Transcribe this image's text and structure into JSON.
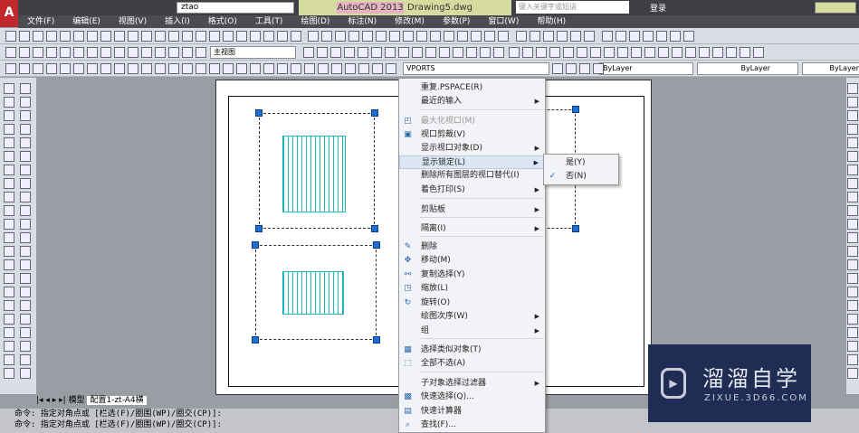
{
  "title": {
    "app": "AutoCAD 2013",
    "document": "Drawing5.dwg",
    "workspace": "ztao",
    "search_placeholder": "键入关键字或短语",
    "login": "登录"
  },
  "menubar": [
    "文件(F)",
    "编辑(E)",
    "视图(V)",
    "插入(I)",
    "格式(O)",
    "工具(T)",
    "绘图(D)",
    "标注(N)",
    "修改(M)",
    "参数(P)",
    "窗口(W)",
    "帮助(H)"
  ],
  "toolbar": {
    "view_select": "主视图",
    "layer_select": "VPORTS",
    "color_select": "ByLayer",
    "linetype_select": "ByLayer",
    "lineweight_select": "ByLayer"
  },
  "tabs": {
    "model": "模型",
    "layout": "配置1-zt-A4横"
  },
  "command_lines": [
    "命令: 指定对角点或 [栏选(F)/圈围(WP)/圈交(CP)]:",
    "命令: 指定对角点或 [栏选(F)/圈围(WP)/圈交(CP)]:"
  ],
  "context_menu": [
    {
      "label": "重复.PSPACE(R)"
    },
    {
      "label": "最近的输入",
      "submenu": true
    },
    {
      "label": "最大化视口(M)",
      "disabled": true,
      "icon": "maximize-viewport-icon"
    },
    {
      "label": "视口剪裁(V)",
      "icon": "viewport-clip-icon"
    },
    {
      "label": "显示视口对象(D)",
      "submenu": true
    },
    {
      "label": "显示锁定(L)",
      "submenu": true,
      "highlighted": true
    },
    {
      "label": "删除所有图层的视口替代(I)"
    },
    {
      "label": "着色打印(S)",
      "submenu": true
    },
    {
      "label": "剪贴板",
      "submenu": true
    },
    {
      "label": "隔离(I)",
      "submenu": true
    },
    {
      "label": "删除",
      "icon": "erase-icon"
    },
    {
      "label": "移动(M)",
      "icon": "move-icon"
    },
    {
      "label": "复制选择(Y)",
      "icon": "copy-icon"
    },
    {
      "label": "缩放(L)",
      "icon": "scale-icon"
    },
    {
      "label": "旋转(O)",
      "icon": "rotate-icon"
    },
    {
      "label": "绘图次序(W)",
      "submenu": true
    },
    {
      "label": "组",
      "submenu": true
    },
    {
      "label": "选择类似对象(T)",
      "icon": "select-similar-icon"
    },
    {
      "label": "全部不选(A)",
      "icon": "deselect-all-icon"
    },
    {
      "label": "子对象选择过滤器",
      "submenu": true
    },
    {
      "label": "快速选择(Q)...",
      "icon": "quick-select-icon"
    },
    {
      "label": "快速计算器",
      "icon": "calculator-icon"
    },
    {
      "label": "查找(F)...",
      "icon": "find-icon"
    }
  ],
  "submenu": [
    {
      "label": "是(Y)",
      "checked": false
    },
    {
      "label": "否(N)",
      "checked": true
    }
  ],
  "watermark": {
    "name": "溜溜自学",
    "url": "ZIXUE.3D66.COM"
  },
  "colors": {
    "accent": "#1e6fd6",
    "drawing": "#1fb8b8",
    "watermark_bg": "#1f2d55"
  }
}
